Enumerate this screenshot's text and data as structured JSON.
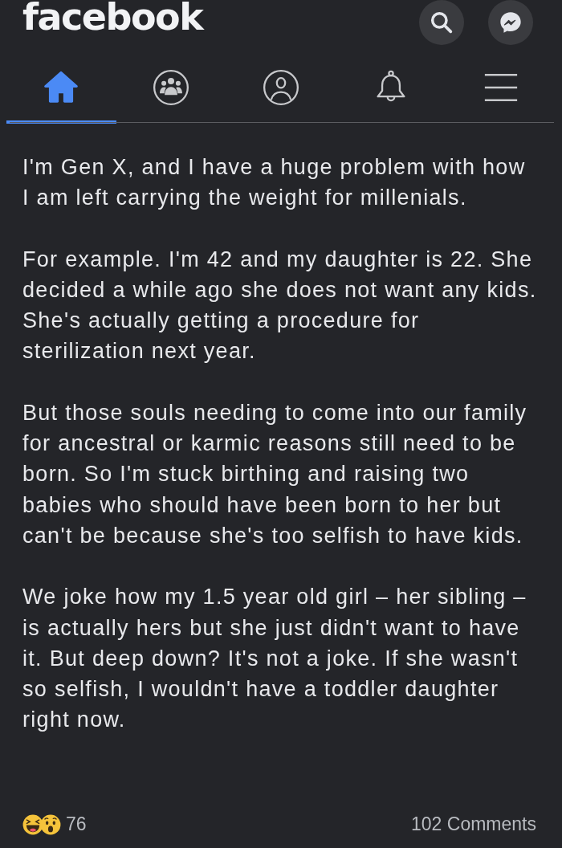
{
  "header": {
    "logo": "facebook",
    "buttons": [
      {
        "kind": "search"
      },
      {
        "kind": "messenger"
      }
    ]
  },
  "nav_tabs": [
    {
      "kind": "home",
      "selected": true
    },
    {
      "kind": "groups",
      "selected": false
    },
    {
      "kind": "profile",
      "selected": false
    },
    {
      "kind": "notifications",
      "selected": false
    },
    {
      "kind": "menu",
      "selected": false
    }
  ],
  "post": {
    "paragraphs": [
      "I'm Gen X, and I have a huge problem with how I am left carrying the weight for millenials.",
      "For example. I'm 42 and my daughter is 22. She decided a while ago she does not want any kids. She's actually getting a procedure for sterilization next year.",
      "But those souls needing to come into our family for ancestral or karmic reasons still need to be born. So I'm stuck birthing and raising two babies who should have been born to her but can't be because she's too selfish to have kids.",
      "We joke how my 1.5 year old girl – her sibling – is actually hers but she just didn't want to have it. But deep down? It's not a joke. If she wasn't so selfish, I wouldn't have a toddler daughter right now."
    ]
  },
  "footer": {
    "reactions": [
      {
        "kind": "haha"
      },
      {
        "kind": "wow"
      }
    ],
    "reaction_count": "76",
    "comments": "102 Comments"
  }
}
